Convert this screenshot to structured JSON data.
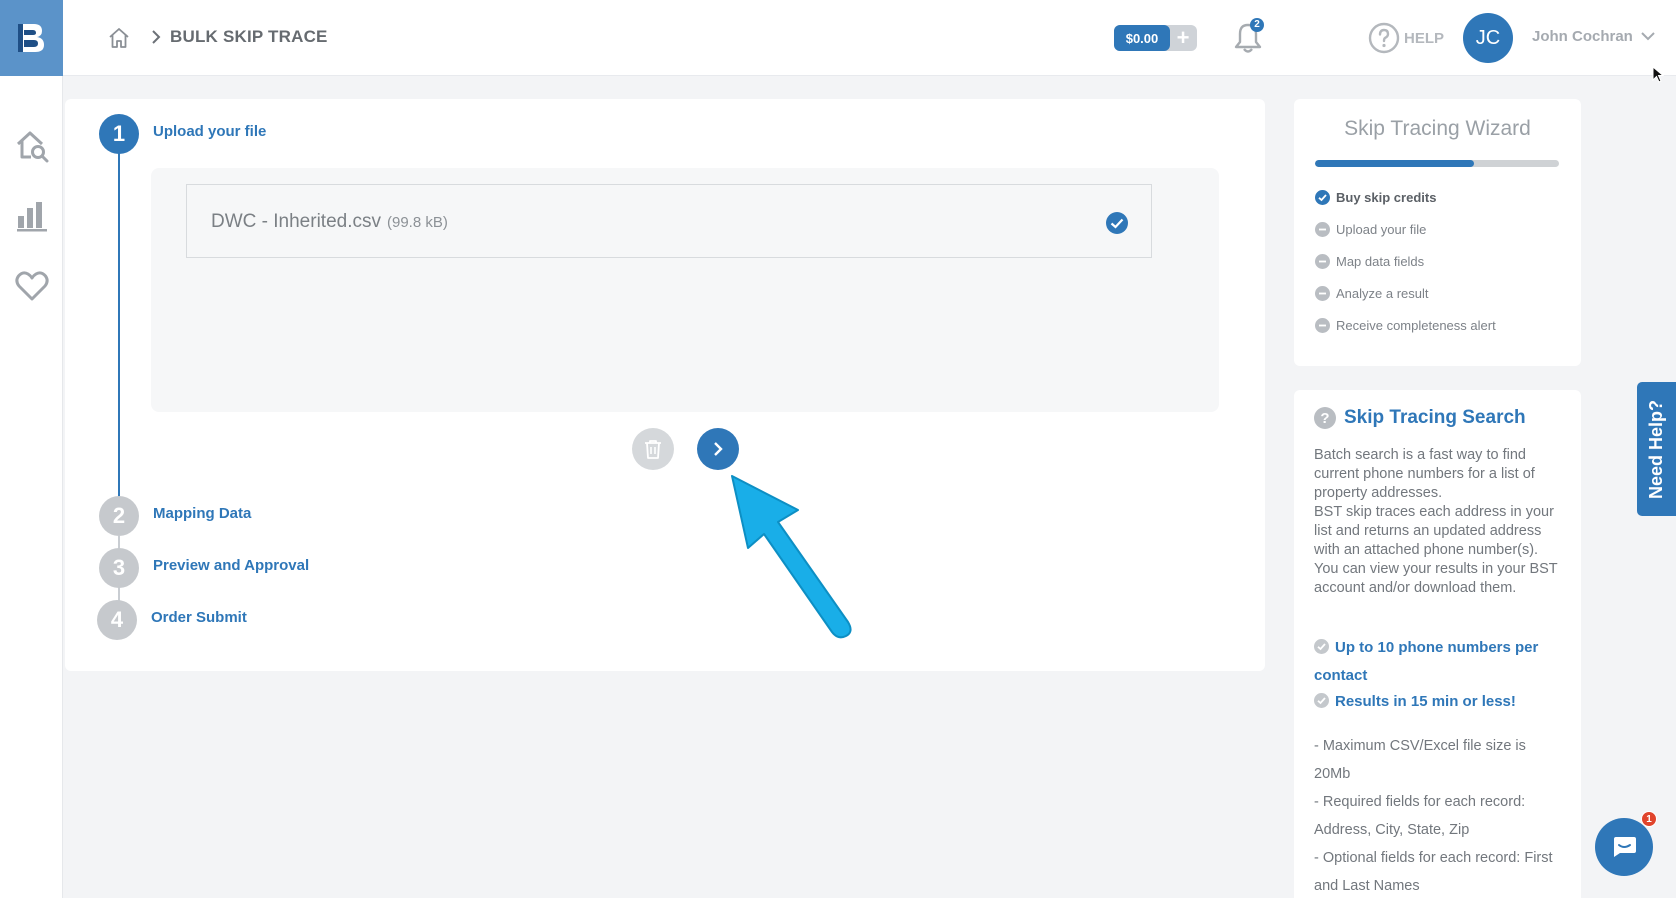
{
  "breadcrumb": {
    "title": "BULK SKIP TRACE"
  },
  "header": {
    "balance": "$0.00",
    "notifications_count": "2",
    "help_label": "HELP",
    "avatar_initials": "JC",
    "user_name": "John Cochran"
  },
  "steps": [
    {
      "number": "1",
      "label": "Upload your file",
      "state": "active"
    },
    {
      "number": "2",
      "label": "Mapping Data",
      "state": "inactive"
    },
    {
      "number": "3",
      "label": "Preview and Approval",
      "state": "inactive"
    },
    {
      "number": "4",
      "label": "Order Submit",
      "state": "inactive"
    }
  ],
  "upload": {
    "file_name": "DWC - Inherited.csv",
    "file_size": "(99.8 kB)"
  },
  "wizard": {
    "title": "Skip Tracing Wizard",
    "progress": 0.65,
    "items": [
      {
        "label": "Buy skip credits",
        "done": true
      },
      {
        "label": "Upload your file",
        "done": false
      },
      {
        "label": "Map data fields",
        "done": false
      },
      {
        "label": "Analyze a result",
        "done": false
      },
      {
        "label": "Receive completeness alert",
        "done": false
      }
    ]
  },
  "info": {
    "title": "Skip Tracing Search",
    "paragraph1": "Batch search is a fast way to find current phone numbers for a list of property addresses.",
    "paragraph2": "BST skip traces each address in your list and returns an updated address with an attached phone number(s). You can view your results in your BST account and/or download them.",
    "features": [
      "Up to 10 phone numbers per contact",
      "Results in 15 min or less!"
    ],
    "limits": [
      "- Maximum CSV/Excel file size is 20Mb",
      "- Required fields for each record: Address, City, State, Zip",
      "- Optional fields for each record: First and Last Names"
    ]
  },
  "need_help_label": "Need Help?",
  "chat_badge": "1",
  "colors": {
    "primary": "#2f77b8",
    "sidebar_logo_bg": "#5b93c9",
    "annotation_arrow": "#19aee8",
    "inactive": "#c6c9cd"
  }
}
